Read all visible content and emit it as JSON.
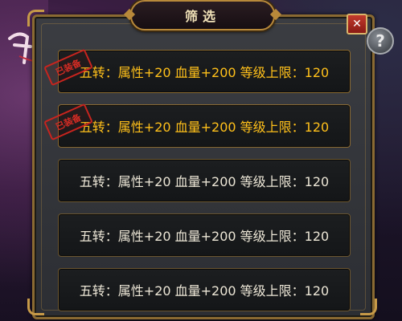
{
  "dialog": {
    "title": "筛选",
    "close_label": "✕",
    "help_label": "?"
  },
  "rows": [
    {
      "text": "五转：属性+20 血量+200 等级上限：120",
      "highlight": true,
      "stamp": "已装备"
    },
    {
      "text": "五转：属性+20 血量+200 等级上限：120",
      "highlight": true,
      "stamp": "已装备"
    },
    {
      "text": "五转：属性+20 血量+200 等级上限：120",
      "highlight": false
    },
    {
      "text": "五转：属性+20 血量+200 等级上限：120",
      "highlight": false
    },
    {
      "text": "五转：属性+20 血量+200 等级上限：120",
      "highlight": false
    }
  ],
  "colors": {
    "highlight_text": "#ffc01a",
    "normal_text": "#ece6d6",
    "frame_gold": "#8a6a32",
    "close_red": "#c23a2c"
  },
  "icons": {
    "close": "close-icon",
    "help": "question-mark-icon",
    "logo": "game-logo"
  }
}
